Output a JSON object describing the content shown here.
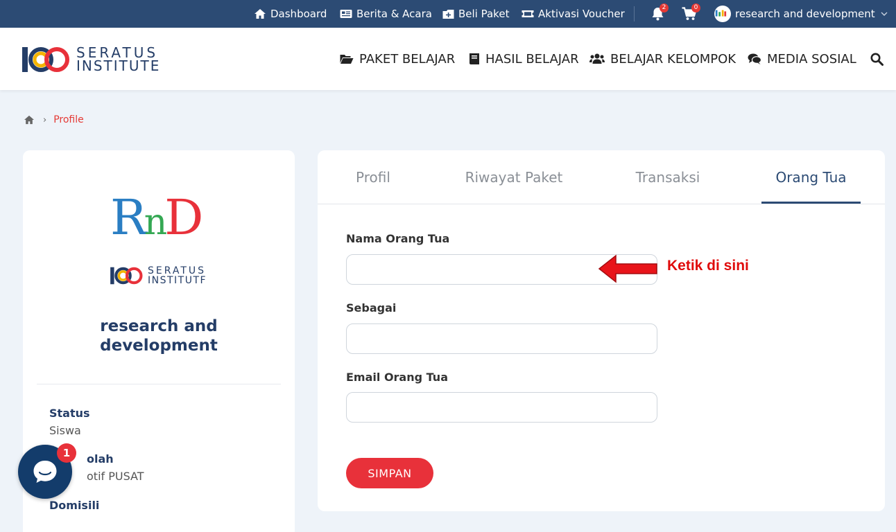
{
  "topbar": {
    "dashboard": "Dashboard",
    "berita": "Berita & Acara",
    "beli_paket": "Beli Paket",
    "aktivasi": "Aktivasi Voucher",
    "notif_count": "2",
    "cart_count": "0",
    "user": "research and development"
  },
  "brand": {
    "line1": "SERATUS",
    "line2": "INSTITUTE"
  },
  "nav": {
    "paket": "PAKET BELAJAR",
    "hasil": "HASIL BELAJAR",
    "kelompok": "BELAJAR KELOMPOK",
    "sosial": "MEDIA SOSIAL"
  },
  "breadcrumb": {
    "current": "Profile"
  },
  "profile": {
    "logo_text": "RnD",
    "mini_brand1": "SERATUS",
    "mini_brand2": "INSTITUTF",
    "name_line1": "research and",
    "name_line2": "development",
    "fields": [
      {
        "label": "Status",
        "value": "Siswa"
      },
      {
        "label": "olah",
        "value": "otif PUSAT"
      },
      {
        "label": "Domisili",
        "value": ""
      }
    ]
  },
  "tabs": [
    "Profil",
    "Riwayat Paket",
    "Transaksi",
    "Orang Tua"
  ],
  "form": {
    "nama_label": "Nama Orang Tua",
    "nama_value": "",
    "sebagai_label": "Sebagai",
    "sebagai_value": "",
    "email_label": "Email Orang Tua",
    "email_value": "",
    "submit": "SIMPAN"
  },
  "annotation": "Ketik di sini",
  "chat": {
    "badge": "1"
  },
  "colors": {
    "navy": "#2c4b74",
    "red": "#e8313a",
    "annotation": "#e00b0b"
  }
}
